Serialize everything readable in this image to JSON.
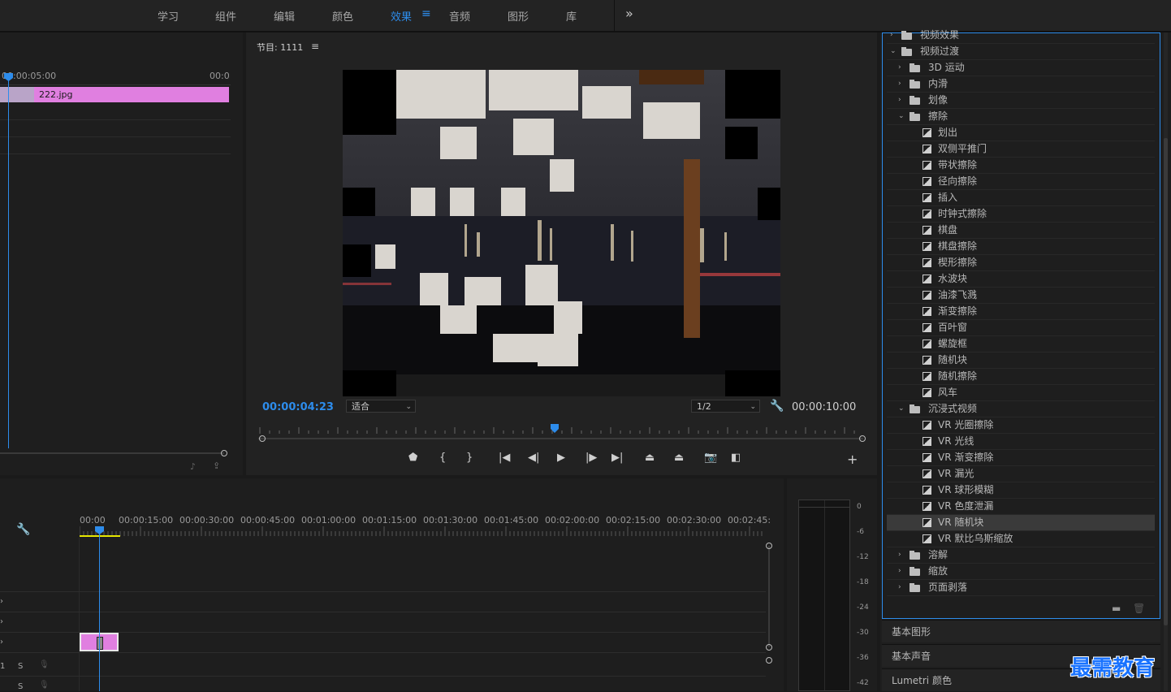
{
  "workspace_tabs": [
    {
      "label": "学习",
      "active": false
    },
    {
      "label": "组件",
      "active": false
    },
    {
      "label": "编辑",
      "active": false
    },
    {
      "label": "颜色",
      "active": false
    },
    {
      "label": "效果",
      "active": true
    },
    {
      "label": "音频",
      "active": false
    },
    {
      "label": "图形",
      "active": false
    },
    {
      "label": "库",
      "active": false
    }
  ],
  "workspace_menu_icon": "hamburger-icon",
  "workspace_more": "»",
  "source": {
    "ruler_start": "00:00:05:00",
    "ruler_end": "00:0",
    "clip_name": "222.jpg"
  },
  "program": {
    "title": "节目: 1111",
    "menu": "≡",
    "current_tc": "00:00:04:23",
    "duration_tc": "00:00:10:00",
    "zoom": "适合",
    "resolution": "1/2",
    "add": "+"
  },
  "timeline": {
    "ruler": [
      "00:00",
      "00:00:15:00",
      "00:00:30:00",
      "00:00:45:00",
      "00:01:00:00",
      "00:01:15:00",
      "00:01:30:00",
      "00:01:45:00",
      "00:02:00:00",
      "00:02:15:00",
      "00:02:30:00",
      "00:02:45:"
    ],
    "tracks": [
      "1",
      "S",
      "S"
    ]
  },
  "meter_db": [
    "0",
    "-6",
    "-12",
    "-18",
    "-24",
    "-30",
    "-36",
    "-42"
  ],
  "effects": {
    "rows": [
      {
        "type": "folder",
        "level": 0,
        "expanded": false,
        "label": "视频效果"
      },
      {
        "type": "folder",
        "level": 0,
        "expanded": true,
        "label": "视频过渡"
      },
      {
        "type": "folder",
        "level": 1,
        "expanded": false,
        "label": "3D 运动"
      },
      {
        "type": "folder",
        "level": 1,
        "expanded": false,
        "label": "内滑"
      },
      {
        "type": "folder",
        "level": 1,
        "expanded": false,
        "label": "划像"
      },
      {
        "type": "folder",
        "level": 1,
        "expanded": true,
        "label": "擦除"
      },
      {
        "type": "fx",
        "label": "划出"
      },
      {
        "type": "fx",
        "label": "双侧平推门"
      },
      {
        "type": "fx",
        "label": "带状擦除"
      },
      {
        "type": "fx",
        "label": "径向擦除"
      },
      {
        "type": "fx",
        "label": "插入"
      },
      {
        "type": "fx",
        "label": "时钟式擦除"
      },
      {
        "type": "fx",
        "label": "棋盘"
      },
      {
        "type": "fx",
        "label": "棋盘擦除"
      },
      {
        "type": "fx",
        "label": "楔形擦除"
      },
      {
        "type": "fx",
        "label": "水波块"
      },
      {
        "type": "fx",
        "label": "油漆飞溅"
      },
      {
        "type": "fx",
        "label": "渐变擦除"
      },
      {
        "type": "fx",
        "label": "百叶窗"
      },
      {
        "type": "fx",
        "label": "螺旋框"
      },
      {
        "type": "fx",
        "label": "随机块"
      },
      {
        "type": "fx",
        "label": "随机擦除"
      },
      {
        "type": "fx",
        "label": "风车"
      },
      {
        "type": "folder",
        "level": 1,
        "expanded": true,
        "label": "沉浸式视频"
      },
      {
        "type": "fx",
        "label": "VR 光圈擦除"
      },
      {
        "type": "fx",
        "label": "VR 光线"
      },
      {
        "type": "fx",
        "label": "VR 渐变擦除"
      },
      {
        "type": "fx",
        "label": "VR 漏光"
      },
      {
        "type": "fx",
        "label": "VR 球形模糊"
      },
      {
        "type": "fx",
        "label": "VR 色度泄漏"
      },
      {
        "type": "fx",
        "label": "VR 随机块",
        "selected": true
      },
      {
        "type": "fx",
        "label": "VR 默比乌斯缩放"
      },
      {
        "type": "folder",
        "level": 1,
        "expanded": false,
        "label": "溶解"
      },
      {
        "type": "folder",
        "level": 1,
        "expanded": false,
        "label": "缩放"
      },
      {
        "type": "folder",
        "level": 1,
        "expanded": false,
        "label": "页面剥落"
      }
    ],
    "panels": [
      "基本图形",
      "基本声音",
      "Lumetri 颜色"
    ]
  },
  "watermark": "最需教育",
  "colors": {
    "accent": "#2d8ceb",
    "clip": "#e07fe0"
  }
}
